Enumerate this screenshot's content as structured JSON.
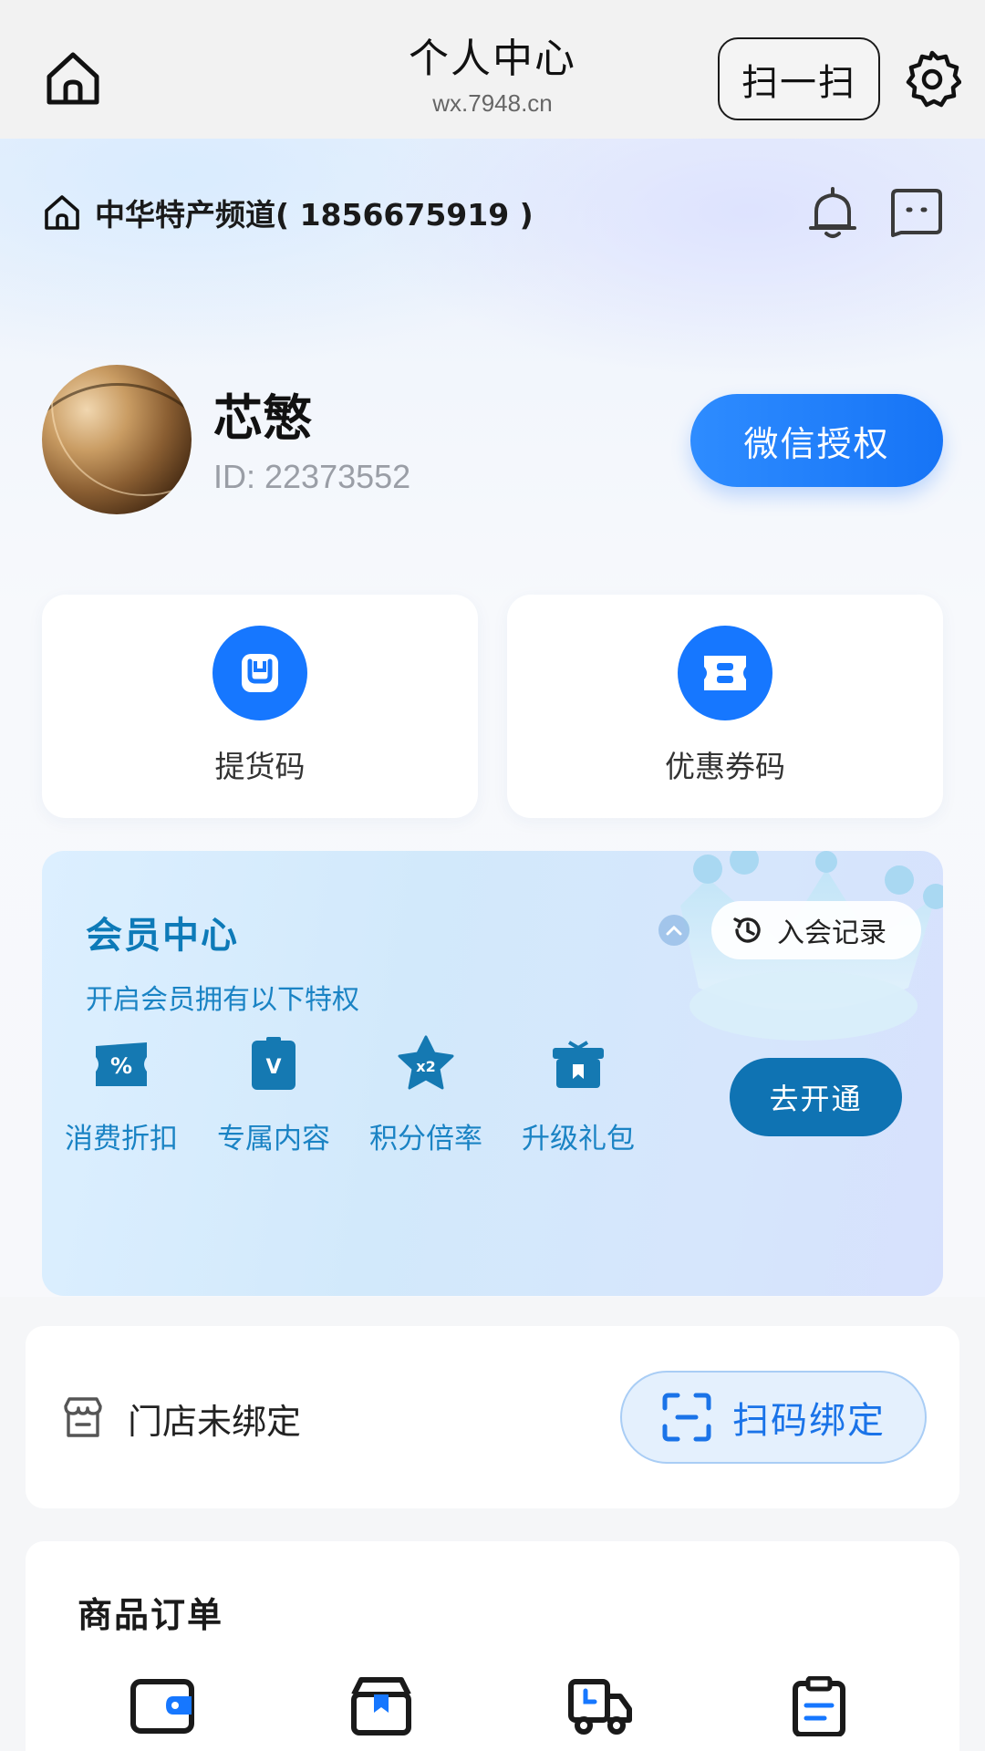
{
  "navbar": {
    "title": "个人中心",
    "subtitle": "wx.7948.cn",
    "scan_label": "扫一扫"
  },
  "shop": {
    "name": "中华特产频道( 1856675919 )"
  },
  "profile": {
    "name": "芯慜",
    "id_text": "ID: 22373552",
    "wechat_auth_label": "微信授权"
  },
  "quick_actions": [
    {
      "label": "提货码",
      "icon": "pickup-code-icon"
    },
    {
      "label": "优惠券码",
      "icon": "coupon-icon"
    }
  ],
  "member": {
    "title": "会员中心",
    "subtitle": "开启会员拥有以下特权",
    "record_label": "入会记录",
    "open_label": "去开通",
    "perks": [
      {
        "label": "消费折扣",
        "icon": "discount-icon"
      },
      {
        "label": "专属内容",
        "icon": "exclusive-content-icon"
      },
      {
        "label": "积分倍率",
        "icon": "points-multiplier-icon"
      },
      {
        "label": "升级礼包",
        "icon": "gift-pack-icon"
      }
    ]
  },
  "store": {
    "status_text": "门店未绑定",
    "bind_label": "扫码绑定"
  },
  "orders": {
    "title": "商品订单",
    "icons": [
      "wallet-icon",
      "package-box-icon",
      "delivery-truck-icon",
      "clipboard-icon"
    ]
  },
  "colors": {
    "primary_blue": "#1677ff",
    "member_blue": "#0f73b3",
    "member_text": "#1a83c4"
  }
}
